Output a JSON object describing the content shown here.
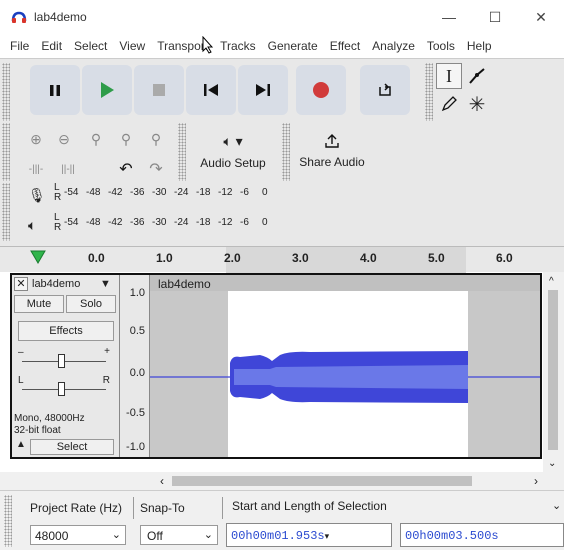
{
  "window": {
    "title": "lab4demo",
    "min": "—",
    "max": "☐",
    "close": "✕"
  },
  "menu": [
    "File",
    "Edit",
    "Select",
    "View",
    "Transport",
    "Tracks",
    "Generate",
    "Effect",
    "Analyze",
    "Tools",
    "Help"
  ],
  "toolbar": {
    "audio_setup": "Audio Setup",
    "share_audio": "Share Audio"
  },
  "meters": {
    "rec_label_l": "L",
    "rec_label_r": "R",
    "play_label_l": "L",
    "play_label_r": "R",
    "ticks": [
      "-54",
      "-48",
      "-42",
      "-36",
      "-30",
      "-24",
      "-18",
      "-12",
      "-6",
      "0"
    ]
  },
  "ruler": {
    "ticks": [
      "0.0",
      "1.0",
      "2.0",
      "3.0",
      "4.0",
      "5.0",
      "6.0"
    ]
  },
  "track": {
    "name": "lab4demo",
    "mute": "Mute",
    "solo": "Solo",
    "effects": "Effects",
    "info1": "Mono, 48000Hz",
    "info2": "32-bit float",
    "select": "Select",
    "gain_l": "L",
    "gain_r": "R",
    "y_ticks": [
      "1.0",
      "0.5",
      "0.0",
      "-0.5",
      "-1.0"
    ],
    "clip_name": "lab4demo"
  },
  "status": {
    "project_rate_label": "Project Rate (Hz)",
    "snap_to_label": "Snap-To",
    "selection_label": "Start and Length of Selection",
    "rate_value": "48000",
    "snap_value": "Off",
    "start_time": "00h00m01.953s",
    "length_time": "00h00m03.500s"
  },
  "colors": {
    "waveform": "#3f46d8",
    "waveform_inner": "#6a78e8",
    "selected_bg": "#ffffff",
    "unselected_bg": "#c8c8c8"
  }
}
